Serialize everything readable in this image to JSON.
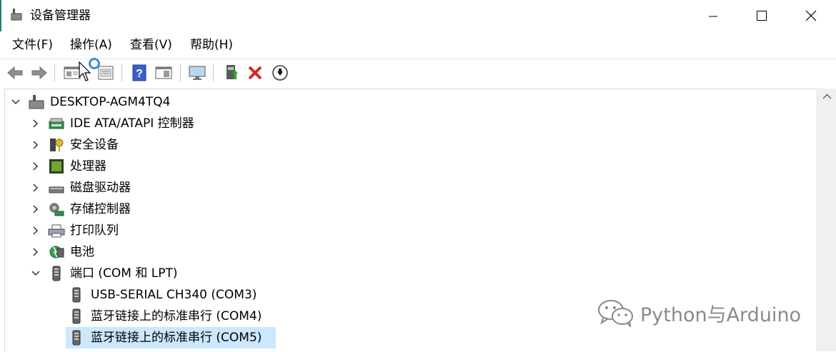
{
  "window": {
    "title": "设备管理器",
    "controls": {
      "minimize": "—",
      "maximize": "☐",
      "close": "✕"
    }
  },
  "menu": [
    {
      "label": "文件(F)"
    },
    {
      "label": "操作(A)"
    },
    {
      "label": "查看(V)"
    },
    {
      "label": "帮助(H)"
    }
  ],
  "toolbar": {
    "buttons": [
      "back-icon",
      "forward-icon",
      "properties-icon",
      "update-driver-list-icon",
      "help-icon",
      "view-icon",
      "monitor-icon",
      "update-driver-icon",
      "uninstall-icon",
      "disable-icon"
    ]
  },
  "tree": {
    "root": "DESKTOP-AGM4TQ4",
    "categories": [
      {
        "label": "IDE ATA/ATAPI 控制器",
        "icon": "ide-controller-icon",
        "expanded": false
      },
      {
        "label": "安全设备",
        "icon": "security-device-icon",
        "expanded": false
      },
      {
        "label": "处理器",
        "icon": "processor-icon",
        "expanded": false
      },
      {
        "label": "磁盘驱动器",
        "icon": "disk-drive-icon",
        "expanded": false
      },
      {
        "label": "存储控制器",
        "icon": "storage-controller-icon",
        "expanded": false
      },
      {
        "label": "打印队列",
        "icon": "print-queue-icon",
        "expanded": false
      },
      {
        "label": "电池",
        "icon": "battery-icon",
        "expanded": false
      },
      {
        "label": "端口 (COM 和 LPT)",
        "icon": "port-icon",
        "expanded": true
      }
    ],
    "ports": [
      {
        "label": "USB-SERIAL CH340 (COM3)"
      },
      {
        "label": "蓝牙链接上的标准串行 (COM4)"
      },
      {
        "label": "蓝牙链接上的标准串行 (COM5)",
        "selected": true
      }
    ]
  },
  "watermark": {
    "text": "Python与Arduino"
  },
  "colors": {
    "selection": "#cce8ff",
    "accent_red": "#d6281e",
    "help_blue": "#3a5fc8"
  }
}
